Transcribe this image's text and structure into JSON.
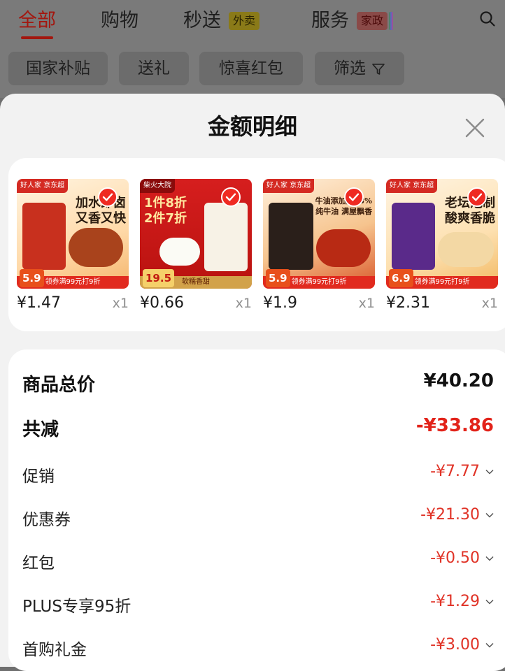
{
  "top_tabs": [
    {
      "label": "全部",
      "active": true
    },
    {
      "label": "购物"
    },
    {
      "label": "秒送",
      "badge": "外卖"
    },
    {
      "label": "服务",
      "badge": "家政"
    }
  ],
  "filters": [
    "国家补贴",
    "送礼",
    "惊喜红包",
    "筛选"
  ],
  "modal": {
    "title": "金额明细",
    "products": [
      {
        "thumb": {
          "brand": "好人家 京东超",
          "headline": "加水即卤\n又香又快",
          "bottom": "领券满99元打9折",
          "badge": "5.9"
        },
        "price": "¥1.47",
        "qty": "x1"
      },
      {
        "thumb": {
          "brand": "柴火大院",
          "headline": "1件8折\n2件7折",
          "bottom": "软糯香甜",
          "badge": "19.5"
        },
        "price": "¥0.66",
        "qty": "x1"
      },
      {
        "thumb": {
          "brand": "好人家 京东超",
          "headline": "牛油添加量48%\n纯牛油 满屋飘香",
          "bottom": "领券满99元打9折",
          "badge": "5.9"
        },
        "price": "¥1.9",
        "qty": "x1"
      },
      {
        "thumb": {
          "brand": "好人家 京东超",
          "headline": "老坛泡制\n酸爽香脆",
          "bottom": "领券满99元打9折",
          "badge": "6.9"
        },
        "price": "¥2.31",
        "qty": "x1"
      }
    ],
    "summary": {
      "total_label": "商品总价",
      "total_value": "¥40.20",
      "reduce_label": "共减",
      "reduce_value": "-¥33.86"
    },
    "breakdown": [
      {
        "label": "促销",
        "value": "-¥7.77"
      },
      {
        "label": "优惠券",
        "value": "-¥21.30"
      },
      {
        "label": "红包",
        "value": "-¥0.50"
      },
      {
        "label": "PLUS专享95折",
        "value": "-¥1.29"
      },
      {
        "label": "首购礼金",
        "value": "-¥3.00"
      }
    ]
  },
  "colors": {
    "accent_red": "#e2231a",
    "text_dark": "#111111",
    "muted_gray": "#8e8e8e"
  }
}
